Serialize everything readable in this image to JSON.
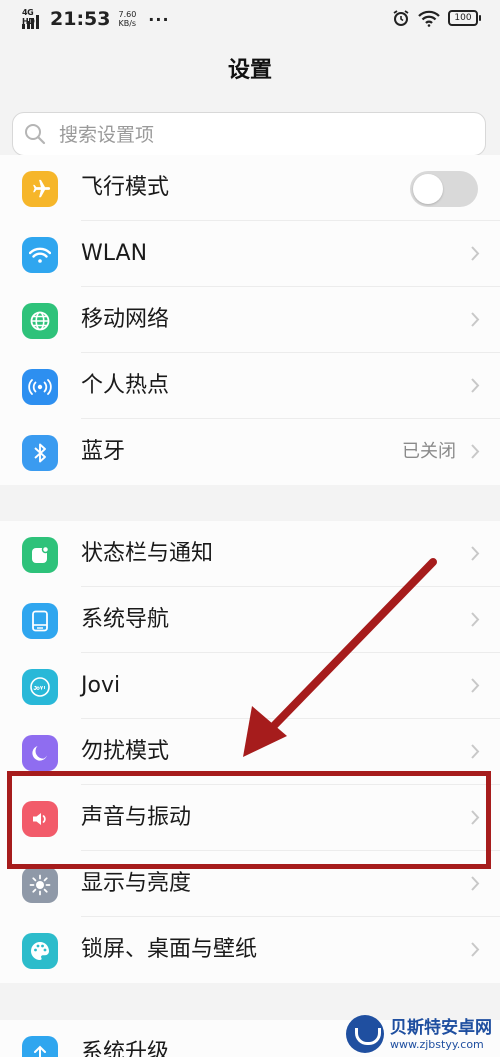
{
  "status_bar": {
    "network": "4G HD",
    "time": "21:53",
    "speed_value": "7.60",
    "speed_unit": "KB/s",
    "more": "···",
    "battery": "100"
  },
  "header": {
    "title": "设置"
  },
  "search": {
    "placeholder": "搜索设置项"
  },
  "group1": [
    {
      "label": "飞行模式",
      "icon": "airplane-icon",
      "color": "#f6b62a",
      "toggle": false
    },
    {
      "label": "WLAN",
      "icon": "wifi-icon",
      "color": "#2fa6ef"
    },
    {
      "label": "移动网络",
      "icon": "globe-icon",
      "color": "#2ec27a"
    },
    {
      "label": "个人热点",
      "icon": "hotspot-icon",
      "color": "#2d8ff0"
    },
    {
      "label": "蓝牙",
      "icon": "bluetooth-icon",
      "color": "#3a9bf0",
      "value": "已关闭"
    }
  ],
  "group2": [
    {
      "label": "状态栏与通知",
      "icon": "notification-icon",
      "color": "#2ec27a"
    },
    {
      "label": "系统导航",
      "icon": "navigation-icon",
      "color": "#2fa6ef"
    },
    {
      "label": "Jovi",
      "icon": "jovi-icon",
      "color": "#29b8d8"
    },
    {
      "label": "勿扰模式",
      "icon": "moon-icon",
      "color": "#8f6df0"
    },
    {
      "label": "声音与振动",
      "icon": "speaker-icon",
      "color": "#f25b6a"
    },
    {
      "label": "显示与亮度",
      "icon": "sun-icon",
      "color": "#8f99a8"
    },
    {
      "label": "锁屏、桌面与壁纸",
      "icon": "palette-icon",
      "color": "#2cbccb"
    }
  ],
  "group3": [
    {
      "label": "系统升级",
      "icon": "upgrade-icon",
      "color": "#2fa6ef"
    }
  ],
  "annotation_color": "#a61c1c",
  "watermark": {
    "name": "贝斯特安卓网",
    "url": "www.zjbstyy.com"
  }
}
